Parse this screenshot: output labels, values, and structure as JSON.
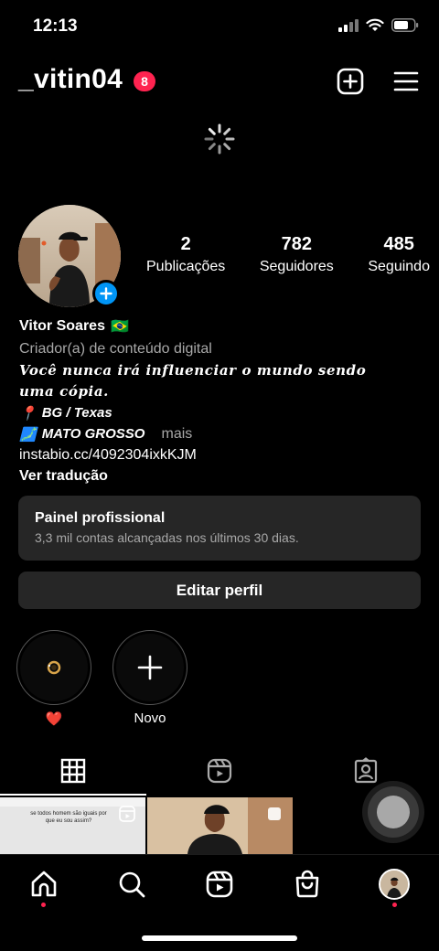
{
  "status_bar": {
    "time": "12:13"
  },
  "header": {
    "username": "_vitin04",
    "notification_count": "8"
  },
  "profile": {
    "stats": [
      {
        "value": "2",
        "label": "Publicações"
      },
      {
        "value": "782",
        "label": "Seguidores"
      },
      {
        "value": "485",
        "label": "Seguindo"
      }
    ]
  },
  "bio": {
    "name": "Vitor Soares",
    "flag": "🇧🇷",
    "category": "Criador(a) de conteúdo digital",
    "quote_line1": "Você nunca irá influenciar o mundo sendo",
    "quote_line2": "uma cópia.",
    "location_icon": "📍",
    "location": "BG / Texas",
    "map_icon": "🗾",
    "state": "MATO GROSSO",
    "more": "mais",
    "link": "instabio.cc/4092304ixkKJM",
    "translate": "Ver tradução"
  },
  "professional_panel": {
    "title": "Painel profissional",
    "subtitle": "3,3 mil contas alcançadas nos últimos 30 dias."
  },
  "edit_profile": {
    "label": "Editar perfil"
  },
  "highlights": [
    {
      "label": "❤️"
    },
    {
      "label": "Novo"
    }
  ],
  "grid_posts": [
    {
      "caption": "se todos homem são iguais por que eu sou assim?"
    }
  ],
  "icons": {
    "status": [
      "signal-icon",
      "wifi-icon",
      "battery-icon"
    ],
    "header": [
      "add-post-icon",
      "menu-icon"
    ],
    "tabs": [
      "grid-icon",
      "reels-icon",
      "tagged-icon"
    ],
    "nav": [
      "home-icon",
      "search-icon",
      "reels-icon",
      "shop-icon",
      "profile-avatar"
    ]
  },
  "colors": {
    "badge": "#ff2350",
    "accent": "#0095f6",
    "panel": "#262626"
  }
}
